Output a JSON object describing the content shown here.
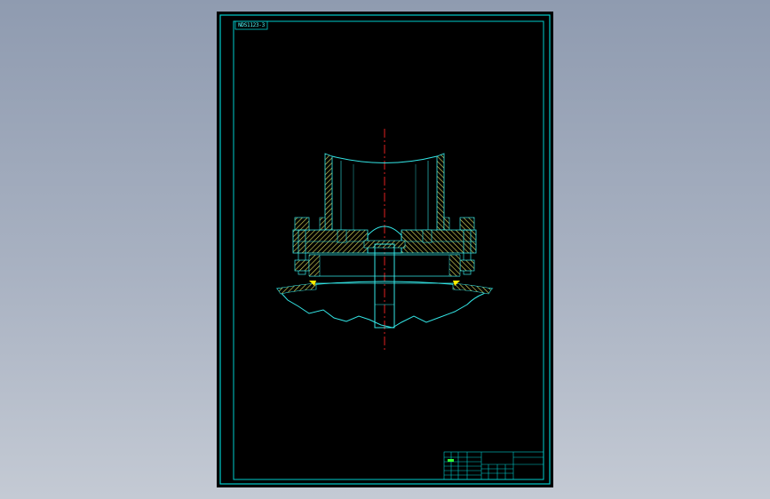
{
  "drawing": {
    "corner_tag": "NDS1123-3",
    "title_block_name": "",
    "title_block_code": ""
  },
  "colors": {
    "sheet": "#000000",
    "border": "#00cccc",
    "part_outline": "#33e6e6",
    "hatch": "#d6d65c",
    "centerline": "#e02020",
    "weld": "#ffee00",
    "title_text": "#33ff33"
  }
}
